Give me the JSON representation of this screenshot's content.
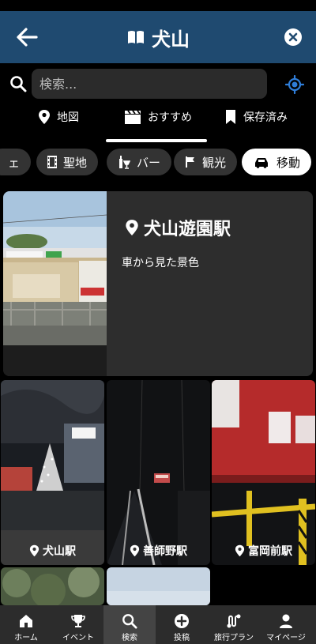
{
  "header": {
    "title": "犬山"
  },
  "search": {
    "placeholder": "検索..."
  },
  "tabs": [
    {
      "label": "地図",
      "icon": "pin-icon"
    },
    {
      "label": "おすすめ",
      "icon": "clapperboard-icon",
      "active": true
    },
    {
      "label": "保存済み",
      "icon": "bookmark-icon"
    }
  ],
  "chips": [
    {
      "label": "ェ"
    },
    {
      "label": "聖地"
    },
    {
      "label": "バー"
    },
    {
      "label": "観光"
    },
    {
      "label": "移動",
      "active": true
    }
  ],
  "feature": {
    "title": "犬山遊園駅",
    "description": "車から見た景色"
  },
  "grid": [
    {
      "label": "犬山駅"
    },
    {
      "label": "善師野駅"
    },
    {
      "label": "富岡前駅"
    }
  ],
  "nav": [
    {
      "label": "ホーム"
    },
    {
      "label": "イベント"
    },
    {
      "label": "検索",
      "active": true
    },
    {
      "label": "投稿"
    },
    {
      "label": "旅行プラン"
    },
    {
      "label": "マイページ"
    }
  ],
  "colors": {
    "header_bg": "#1f4a70",
    "accent_blue": "#2f7dd8",
    "card_bg": "#2d2d2d",
    "nav_bg": "#2c2c2c"
  }
}
